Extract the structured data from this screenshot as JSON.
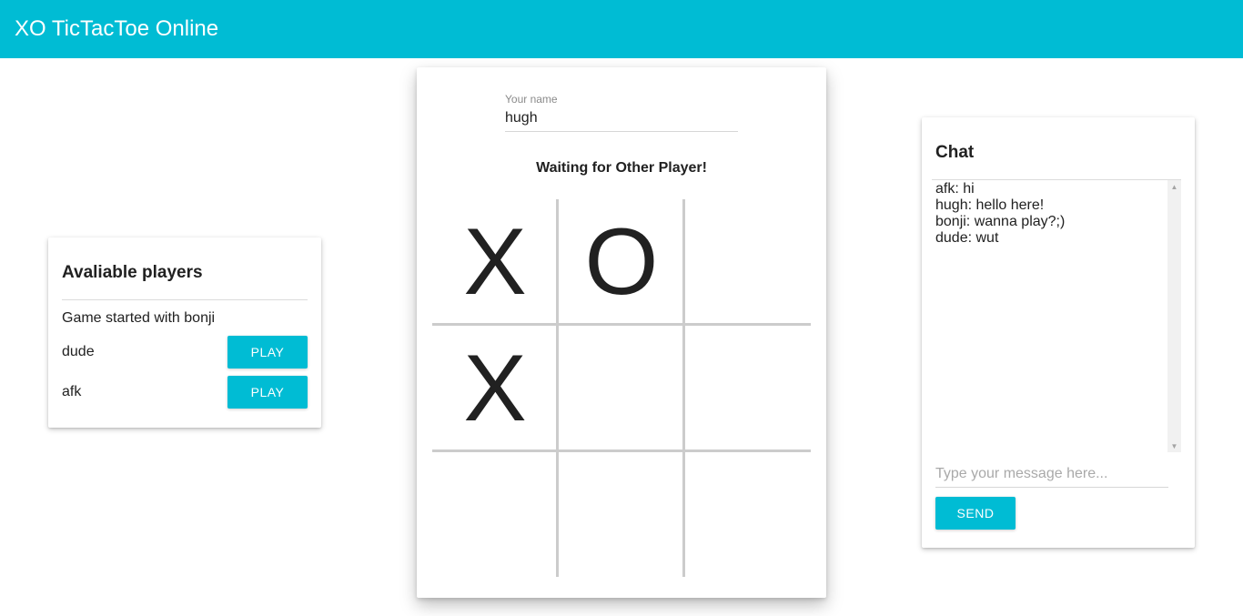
{
  "header": {
    "title": "XO TicTacToe Online"
  },
  "players": {
    "title": "Avaliable players",
    "status": "Game started with bonji",
    "list": [
      {
        "name": "dude",
        "button": "PLAY"
      },
      {
        "name": "afk",
        "button": "PLAY"
      }
    ]
  },
  "game": {
    "name_label": "Your name",
    "name_value": "hugh",
    "status": "Waiting for Other Player!",
    "board": [
      "X",
      "O",
      "",
      "X",
      "",
      "",
      "",
      "",
      ""
    ]
  },
  "chat": {
    "title": "Chat",
    "messages": [
      "afk: hi",
      "hugh: hello here!",
      "bonji: wanna play?;)",
      "dude: wut"
    ],
    "input_placeholder": "Type your message here...",
    "send_label": "SEND"
  },
  "colors": {
    "accent": "#00bcd4",
    "grid": "#cccccc"
  },
  "icons": {
    "scroll_up": "triangle-up-icon",
    "scroll_down": "triangle-down-icon"
  }
}
